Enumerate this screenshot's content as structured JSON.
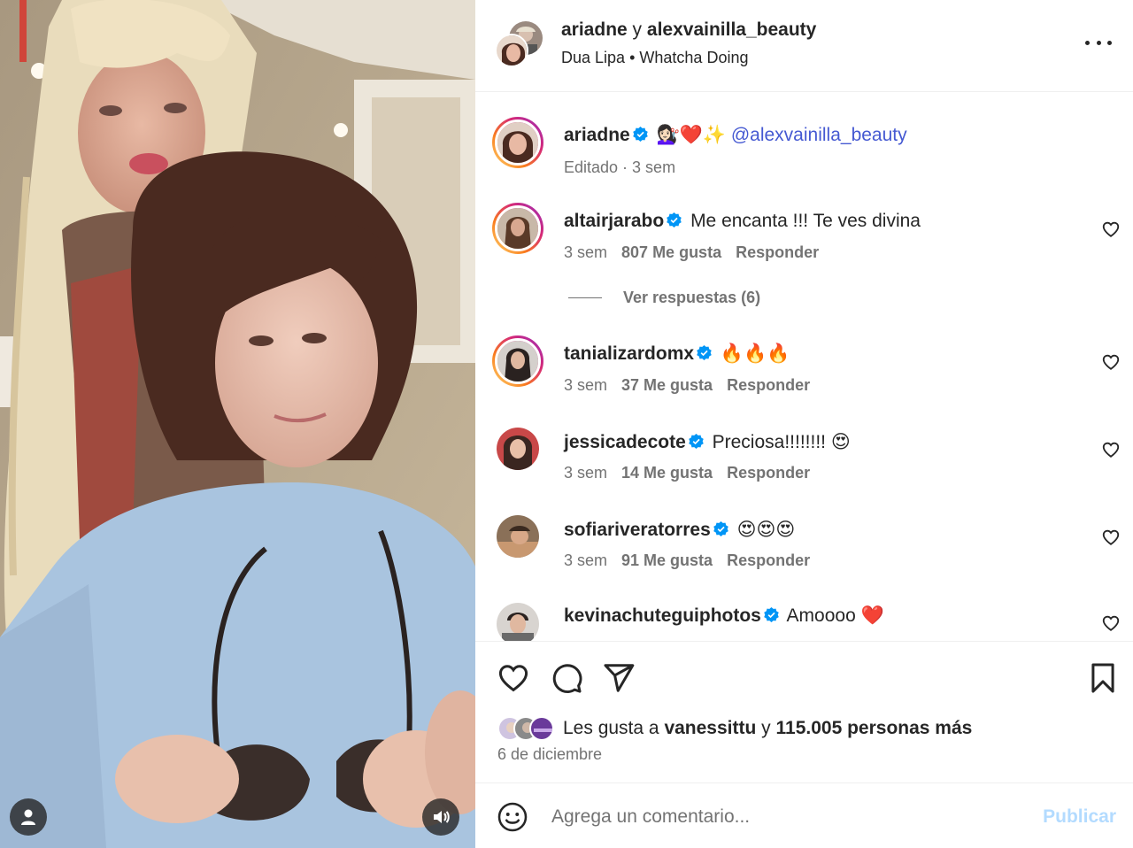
{
  "header": {
    "user1": "ariadne",
    "connector": "y",
    "user2": "alexvainilla_beauty",
    "artist": "Dua Lipa",
    "separator": "•",
    "song": "Whatcha Doing"
  },
  "caption": {
    "username": "ariadne",
    "emojis": "💇🏻‍♀️❤️✨",
    "mention": "@alexvainilla_beauty",
    "meta": "Editado · 3 sem"
  },
  "comments": [
    {
      "username": "altairjarabo",
      "text": "Me encanta !!! Te ves divina",
      "time": "3 sem",
      "likes": "807 Me gusta",
      "reply": "Responder"
    },
    {
      "username": "tanializardomx",
      "text": "🔥🔥🔥",
      "time": "3 sem",
      "likes": "37 Me gusta",
      "reply": "Responder"
    },
    {
      "username": "jessicadecote",
      "text": "Preciosa!!!!!!!! 😍",
      "time": "3 sem",
      "likes": "14 Me gusta",
      "reply": "Responder"
    },
    {
      "username": "sofiariveratorres",
      "text": "😍😍😍",
      "time": "3 sem",
      "likes": "91 Me gusta",
      "reply": "Responder"
    },
    {
      "username": "kevinachuteguiphotos",
      "text": "Amoooo ❤️",
      "time": "",
      "likes": "",
      "reply": ""
    }
  ],
  "view_replies": "Ver respuestas (6)",
  "likes": {
    "prefix": "Les gusta a",
    "user": "vanessittu",
    "middle": "y",
    "others": "115.005 personas más"
  },
  "date": "6 de diciembre",
  "composer": {
    "placeholder": "Agrega un comentario...",
    "publish": "Publicar"
  },
  "colors": {
    "verified": "#0095f6",
    "mention": "#4559d2",
    "secondary_text": "#737373",
    "publish_disabled": "#b3dbff"
  }
}
